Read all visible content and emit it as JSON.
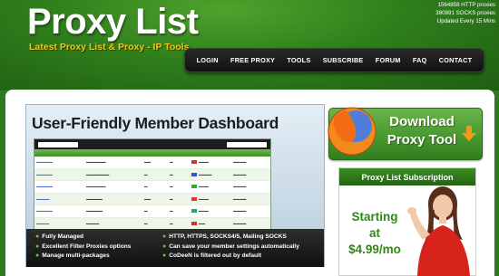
{
  "header": {
    "title": "Proxy List",
    "tagline": "Latest Proxy List & Proxy - IP Tools",
    "stats": [
      "1564858 HTTP proxies",
      "380891 SOCKS proxies",
      "Updated Every 15 Mins"
    ]
  },
  "nav": {
    "items": [
      "LOGIN",
      "FREE PROXY",
      "TOOLS",
      "SUBSCRIBE",
      "FORUM",
      "FAQ",
      "CONTACT"
    ]
  },
  "dashboard": {
    "title": "User-Friendly Member Dashboard",
    "features_left": [
      "Fully Managed",
      "Excellent Filter Proxies options",
      "Manage multi-packages"
    ],
    "features_right": [
      "HTTP, HTTPS, SOCKS4/5, Mailing SOCKS",
      "Can save your member settings automatically",
      "CoDeeN is filtered out by default"
    ]
  },
  "download": {
    "line1": "Download",
    "line2": "Proxy Tool"
  },
  "subscription": {
    "title": "Proxy List Subscription",
    "line1": "Starting",
    "line2": "at",
    "price": "$4.99/mo"
  },
  "colors": {
    "brand_green": "#2f7a1e",
    "accent_yellow": "#f2c51b",
    "price_green": "#2f8a14",
    "arrow_orange": "#f29a1b"
  }
}
